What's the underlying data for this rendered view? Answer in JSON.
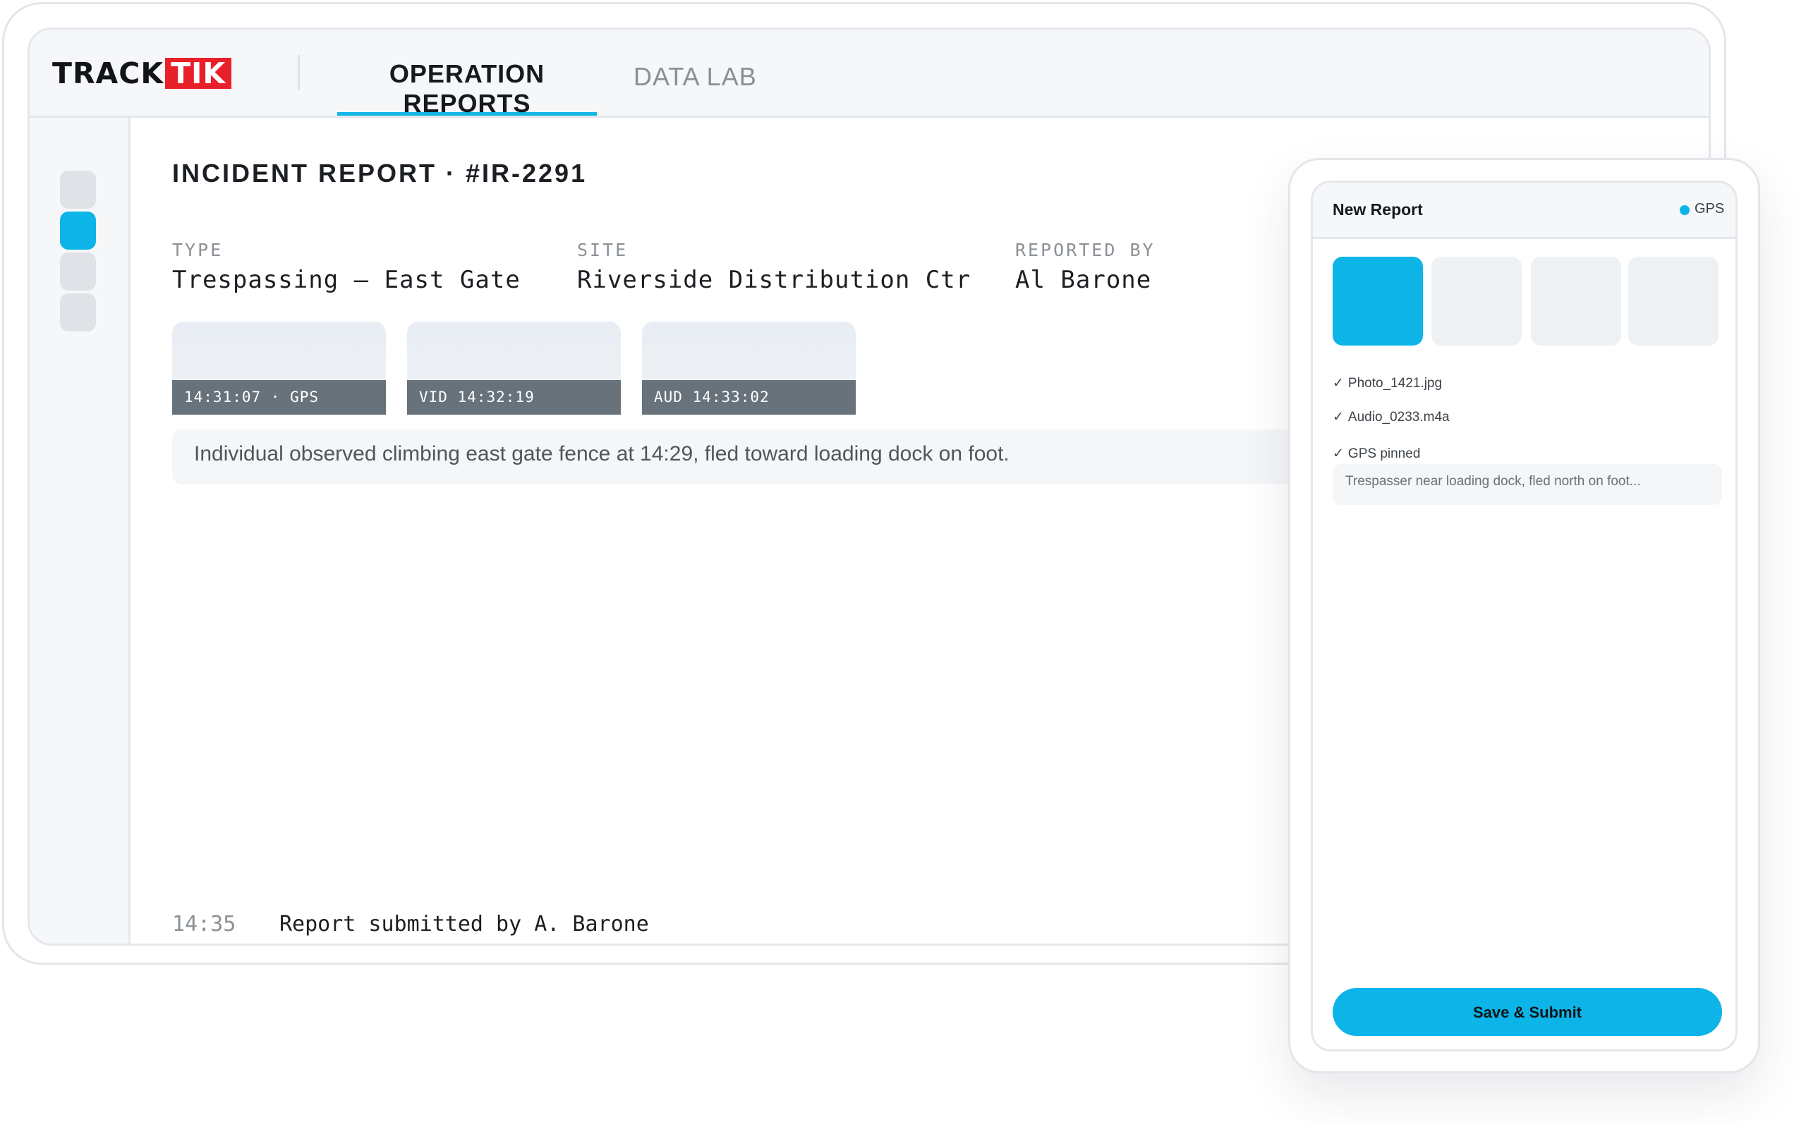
{
  "brand": {
    "logo_part1": "TRACK",
    "logo_part2": "TIK",
    "accent": "#0cb4e8",
    "logo_red": "#e8202a"
  },
  "nav": {
    "tabs": [
      {
        "label": "OPERATION REPORTS",
        "active": true
      },
      {
        "label": "DATA LAB",
        "active": false
      }
    ]
  },
  "sidebar": {
    "items": [
      {
        "active": false
      },
      {
        "active": true
      },
      {
        "active": false
      },
      {
        "active": false
      }
    ]
  },
  "report": {
    "title": "INCIDENT REPORT · #IR-2291",
    "fields": [
      {
        "label": "TYPE",
        "value": "Trespassing — East Gate"
      },
      {
        "label": "SITE",
        "value": "Riverside Distribution Ctr"
      },
      {
        "label": "REPORTED BY",
        "value": "Al Barone"
      }
    ],
    "media": [
      {
        "caption": "14:31:07 · GPS"
      },
      {
        "caption": "VID 14:32:19"
      },
      {
        "caption": "AUD 14:33:02"
      }
    ],
    "notes": "Individual observed climbing east gate fence at 14:29, fled toward loading dock on foot.",
    "log": {
      "time": "14:35",
      "text": "Report submitted by A. Barone"
    }
  },
  "mobile": {
    "title": "New Report",
    "gps_label": "GPS",
    "attachments": [
      "✓",
      "Photo_1421.jpg",
      "Audio_0233.m4a",
      "GPS pinned"
    ],
    "note": "Trespasser near loading dock, fled north on foot...",
    "submit_label": "Save & Submit"
  }
}
